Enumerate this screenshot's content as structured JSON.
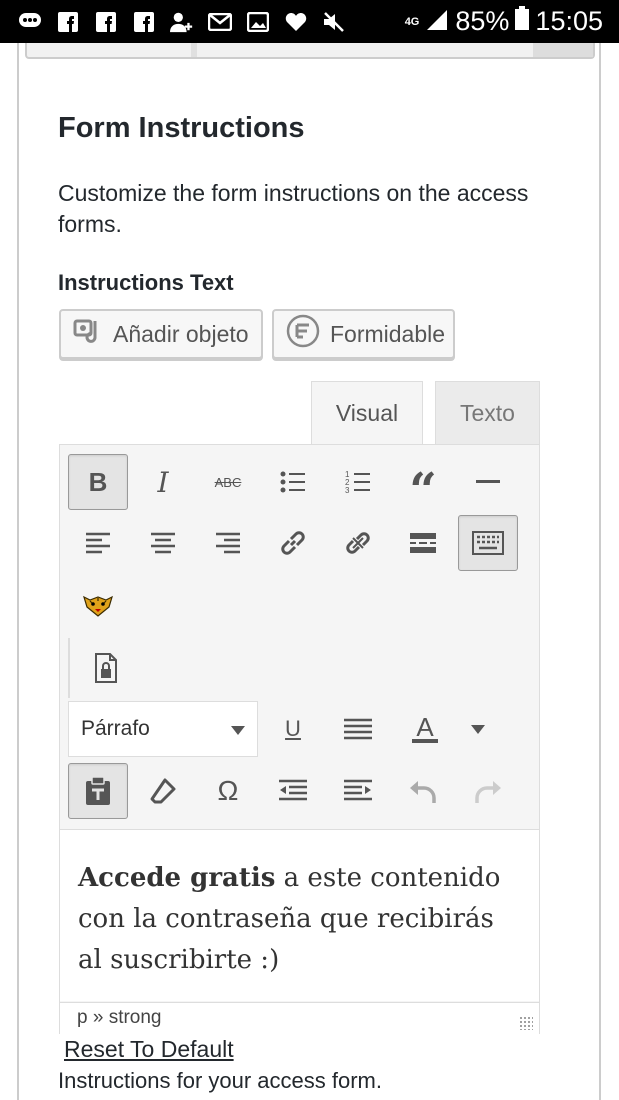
{
  "statusbar": {
    "network": "4G",
    "battery": "85%",
    "time": "15:05",
    "icons": [
      "message-icon",
      "facebook-icon",
      "facebook-icon",
      "facebook-icon",
      "add-person-icon",
      "gmail-icon",
      "image-icon",
      "heart-icon",
      "mute-icon",
      "signal-icon",
      "battery-icon"
    ]
  },
  "section": {
    "title": "Form Instructions",
    "description": "Customize the form instructions on the access forms.",
    "label": "Instructions Text"
  },
  "media_buttons": {
    "add_media": "Añadir objeto",
    "formidable": "Formidable"
  },
  "tabs": {
    "visual": "Visual",
    "text": "Texto"
  },
  "toolbar": {
    "format_select": "Párrafo",
    "bold": "B",
    "italic": "I",
    "strike": "ABC",
    "blockquote": "“",
    "special_char": "Ω",
    "underline": "U",
    "text_color": "A"
  },
  "editor": {
    "content_bold": "Accede gratis",
    "content_rest": " a este contenido con la contraseña que recibirás al suscribirte :)",
    "path": "p » strong"
  },
  "footer": {
    "reset": "Reset To Default",
    "help": "Instructions for your access form."
  },
  "colors": {
    "text": "#23282d",
    "toolbar_bg": "#f5f5f5",
    "border": "#dddddd",
    "statusbar_bg": "#000000"
  }
}
